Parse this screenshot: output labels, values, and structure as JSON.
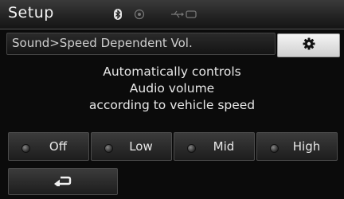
{
  "header": {
    "title": "Setup",
    "indicators": [
      "bluetooth-icon",
      "record-icon",
      "usb-icon"
    ]
  },
  "breadcrumb": {
    "text": "Sound>Speed Dependent Vol."
  },
  "settings_button": {
    "icon": "gear-icon"
  },
  "description": [
    "Automatically controls",
    "Audio volume",
    "according to vehicle speed"
  ],
  "options": [
    {
      "label": "Off"
    },
    {
      "label": "Low"
    },
    {
      "label": "Mid"
    },
    {
      "label": "High"
    }
  ],
  "back_button": {
    "icon": "back-arrow-icon"
  }
}
